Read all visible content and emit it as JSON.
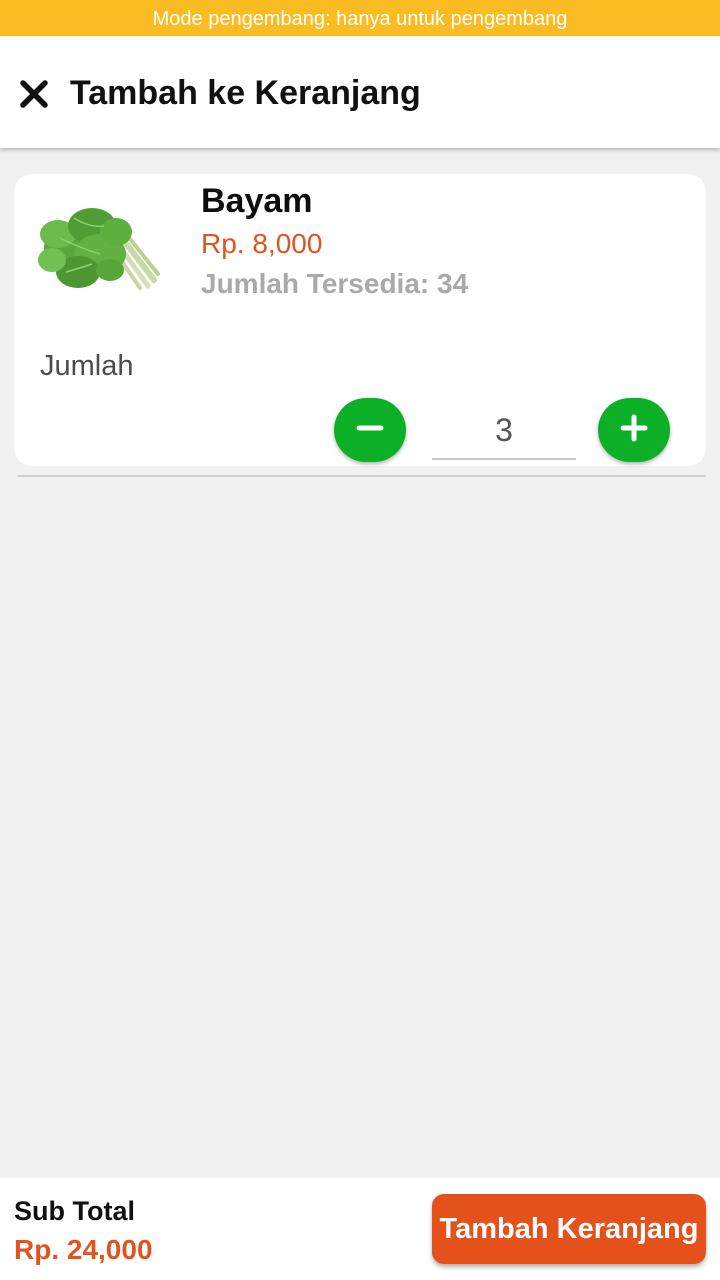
{
  "status_banner": "Mode pengembang: hanya untuk pengembang",
  "header": {
    "title": "Tambah ke Keranjang",
    "close_icon": "close-icon"
  },
  "product": {
    "name": "Bayam",
    "price": "Rp. 8,000",
    "stock": "Jumlah Tersedia: 34",
    "image_icon": "spinach-image"
  },
  "quantity": {
    "label": "Jumlah",
    "value": "3",
    "decrease_icon": "minus-icon",
    "increase_icon": "plus-icon"
  },
  "footer": {
    "subtotal_label": "Sub Total",
    "subtotal_value": "Rp. 24,000",
    "add_button_label": "Tambah Keranjang"
  },
  "colors": {
    "banner": "#fbbc23",
    "accent": "#e4511b",
    "price": "#e2541f",
    "stepper": "#0bb026",
    "stock_text": "#a9a9a9",
    "background": "#f1f1f1"
  }
}
